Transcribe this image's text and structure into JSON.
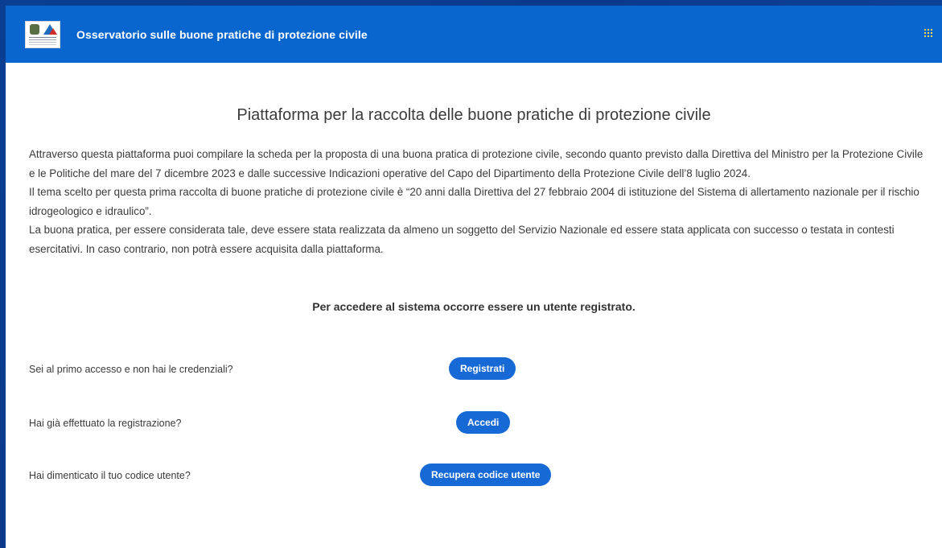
{
  "header": {
    "title": "Osservatorio sulle buone pratiche di protezione civile",
    "logo_icon": "protezione-civile-logo-icon",
    "apps_icon": "apps-grid-icon",
    "colors": {
      "bar": "#0a66cf",
      "apps_dots": "#ffd54a"
    }
  },
  "main": {
    "title": "Piattaforma per la raccolta delle buone pratiche di protezione civile",
    "paragraphs": [
      "Attraverso questa piattaforma puoi compilare la scheda per la proposta di una buona pratica di protezione civile, secondo quanto previsto dalla Direttiva del Ministro per la Protezione Civile e le Politiche del mare del 7 dicembre 2023 e dalle successive Indicazioni operative del Capo del Dipartimento della Protezione Civile dell’8 luglio 2024.",
      "Il tema scelto per questa prima raccolta di buone pratiche di protezione civile è “20 anni dalla Direttiva del 27 febbraio 2004 di istituzione del Sistema di allertamento nazionale per il rischio idrogeologico e idraulico”.",
      "La buona pratica, per essere considerata tale, deve essere stata realizzata da almeno un soggetto del Servizio Nazionale ed essere stata applicata con successo o testata in contesti esercitativi. In caso contrario, non potrà essere acquisita dalla piattaforma."
    ],
    "notice": "Per accedere al sistema occorre essere un utente registrato.",
    "actions": [
      {
        "question": "Sei al primo accesso e non hai le credenziali?",
        "button": "Registrati"
      },
      {
        "question": "Hai già effettuato la registrazione?",
        "button": "Accedi"
      },
      {
        "question": "Hai dimenticato il tuo codice utente?",
        "button": "Recupera codice utente"
      }
    ],
    "colors": {
      "button": "#1769d6"
    }
  }
}
